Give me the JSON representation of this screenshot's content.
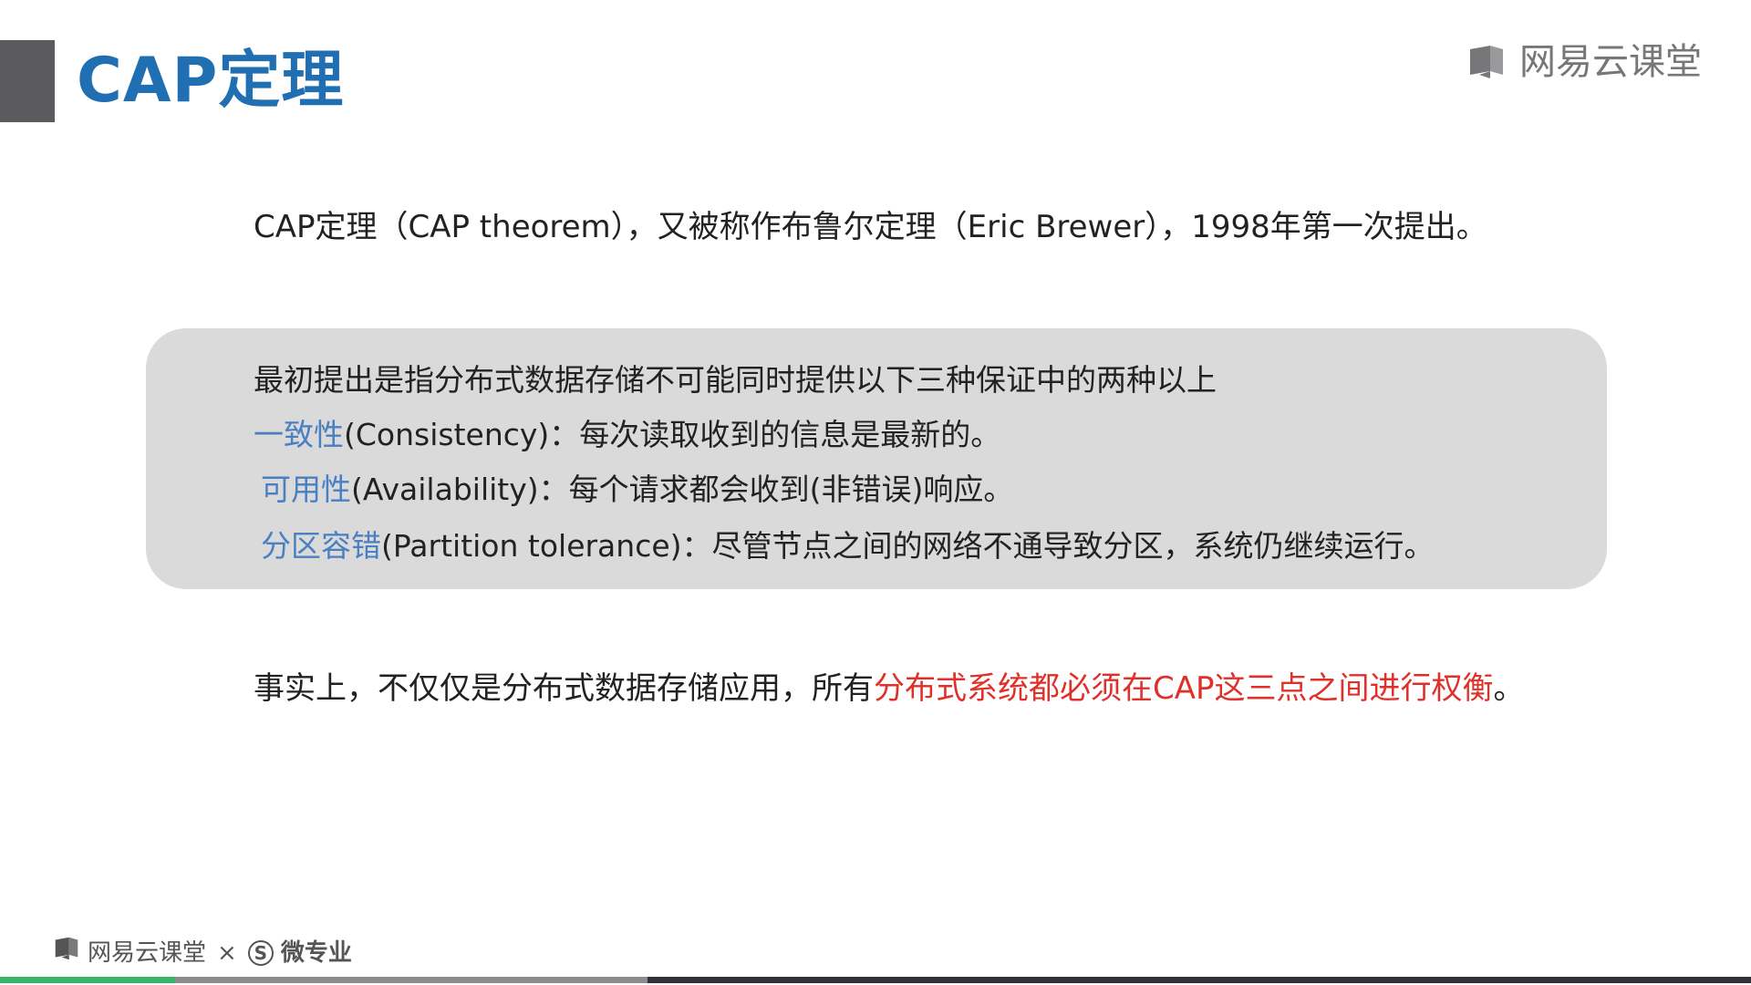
{
  "title": "CAP定理",
  "brand": {
    "top": "网易云课堂",
    "bottom": "网易云课堂",
    "times": "×",
    "sub_logo": "S",
    "sub_name": "微专业"
  },
  "intro": "CAP定理（CAP theorem），又被称作布鲁尔定理（Eric Brewer），1998年第一次提出。",
  "box": {
    "lead": "最初提出是指分布式数据存储不可能同时提供以下三种保证中的两种以上",
    "items": [
      {
        "term": "一致性",
        "rest": "(Consistency)：每次读取收到的信息是最新的。"
      },
      {
        "term": "可用性",
        "rest": "(Availability)：每个请求都会收到(非错误)响应。"
      },
      {
        "term": "分区容错",
        "rest": "(Partition tolerance)：尽管节点之间的网络不通导致分区，系统仍继续运行。"
      }
    ]
  },
  "conclusion": {
    "plain": "事实上，不仅仅是分布式数据存储应用，所有",
    "highlight": "分布式系统都必须在CAP这三点之间进行权衡",
    "end": "。"
  },
  "playback": {
    "played_fraction": 0.1,
    "buffered_fraction": 0.37
  },
  "colors": {
    "title": "#1f6fb2",
    "term": "#4a7fc1",
    "highlight": "#e0302a",
    "box_bg": "#dadada",
    "progress_played": "#39b36a"
  }
}
